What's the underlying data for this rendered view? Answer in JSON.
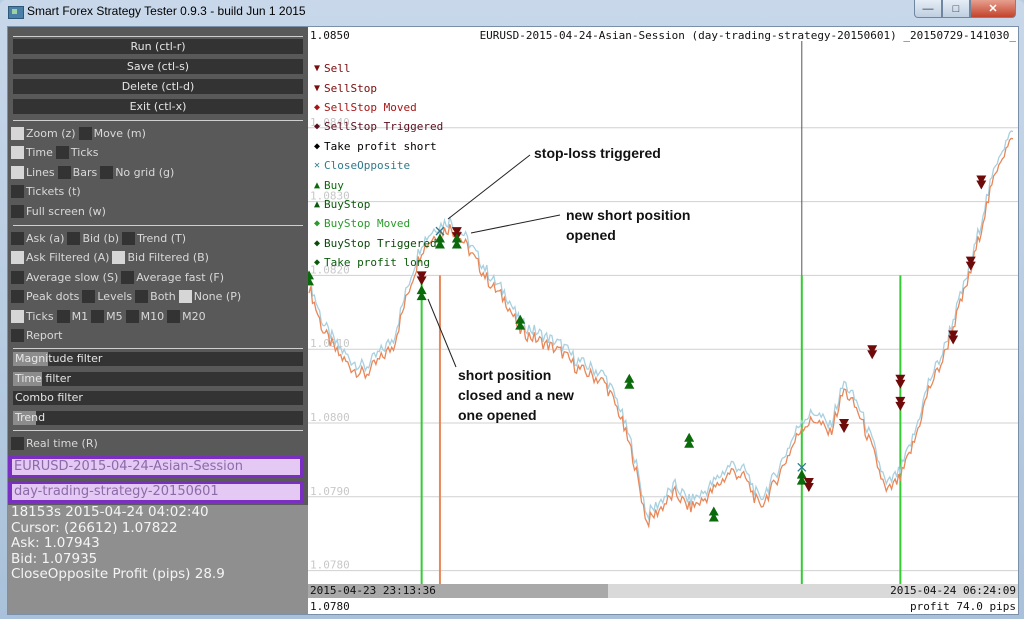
{
  "window": {
    "title": "Smart Forex Strategy Tester 0.9.3 - build Jun  1 2015",
    "controls": {
      "minimize": "—",
      "maximize": "□",
      "close": "✕"
    }
  },
  "panel": {
    "buttons": [
      {
        "label": "Run  (ctl-r)"
      },
      {
        "label": "Save  (ctl-s)"
      },
      {
        "label": "Delete  (ctl-d)"
      },
      {
        "label": "Exit  (ctl-x)"
      }
    ],
    "option_rows": [
      [
        {
          "label": "Zoom  (z)",
          "checked": true
        },
        {
          "label": "Move  (m)",
          "checked": false
        }
      ],
      [
        {
          "label": "Time",
          "checked": true
        },
        {
          "label": "Ticks",
          "checked": false
        }
      ],
      [
        {
          "label": "Lines",
          "checked": true
        },
        {
          "label": "Bars",
          "checked": false
        },
        {
          "label": "No  grid  (g)",
          "checked": false
        }
      ],
      [
        {
          "label": "Tickets  (t)",
          "checked": false
        }
      ],
      [
        {
          "label": "Full  screen  (w)",
          "checked": false
        }
      ]
    ],
    "indicator_rows": [
      [
        {
          "label": "Ask  (a)",
          "checked": false
        },
        {
          "label": "Bid  (b)",
          "checked": false
        },
        {
          "label": "Trend  (T)",
          "checked": false
        }
      ],
      [
        {
          "label": "Ask  Filtered  (A)",
          "checked": true
        },
        {
          "label": "Bid  Filtered  (B)",
          "checked": true
        }
      ],
      [
        {
          "label": "Average  slow  (S)",
          "checked": false
        },
        {
          "label": "Average  fast  (F)",
          "checked": false
        }
      ],
      [
        {
          "label": "Peak  dots",
          "checked": false
        },
        {
          "label": "Levels",
          "checked": false
        },
        {
          "label": "Both",
          "checked": false
        },
        {
          "label": "None  (P)",
          "checked": true
        }
      ],
      [
        {
          "label": "Ticks",
          "checked": true
        },
        {
          "label": "M1",
          "checked": false
        },
        {
          "label": "M5",
          "checked": false
        },
        {
          "label": "M10",
          "checked": false
        },
        {
          "label": "M20",
          "checked": false
        }
      ],
      [
        {
          "label": "Report",
          "checked": false
        }
      ]
    ],
    "sliders": [
      {
        "label": "Magnitude  filter",
        "value": 0.12
      },
      {
        "label": "Time  filter",
        "value": 0.1
      },
      {
        "label": "Combo  filter",
        "value": 0.0
      },
      {
        "label": "Trend",
        "value": 0.08
      }
    ],
    "realtime": {
      "label": "Real  time  (R)",
      "checked": false
    },
    "dataset_name": "EURUSD-2015-04-24-Asian-Session",
    "strategy_name": "day-trading-strategy-20150601",
    "info_lines": [
      "18153s  2015-04-24  04:02:40",
      "Cursor:  (26612)  1.07822",
      "Ask:  1.07943",
      "Bid:  1.07935",
      "CloseOpposite  Profit  (pips)  28.9"
    ]
  },
  "chart": {
    "top_price": "1.0850",
    "title": "EURUSD-2015-04-24-Asian-Session (day-trading-strategy-20150601) _20150729-141030_",
    "x_start": "2015-04-23 23:13:36",
    "x_end": "2015-04-24 06:24:09",
    "bottom_price": "1.0780",
    "profit": "profit 74.0 pips",
    "legend": [
      {
        "label": "Sell",
        "glyph": "▼",
        "color": "#7a0c0c",
        "icon": "sell-icon"
      },
      {
        "label": "SellStop",
        "glyph": "▼",
        "color": "#7a0c0c",
        "icon": "sellstop-icon"
      },
      {
        "label": "SellStop Moved",
        "glyph": "◆",
        "color": "#a81414",
        "icon": "sellstop-moved-icon"
      },
      {
        "label": "SellStop Triggered",
        "glyph": "◆",
        "color": "#5a0e1e",
        "icon": "sellstop-triggered-icon"
      },
      {
        "label": "Take profit short",
        "glyph": "◆",
        "color": "#000000",
        "icon": "take-profit-short-icon"
      },
      {
        "label": "CloseOpposite",
        "glyph": "✕",
        "color": "#2f7a8a",
        "icon": "close-opposite-icon"
      },
      {
        "label": "Buy",
        "glyph": "▲",
        "color": "#0b6a0b",
        "icon": "buy-icon"
      },
      {
        "label": "BuyStop",
        "glyph": "▲",
        "color": "#0b5a0b",
        "icon": "buystop-icon"
      },
      {
        "label": "BuyStop Moved",
        "glyph": "◆",
        "color": "#2a9a2a",
        "icon": "buystop-moved-icon"
      },
      {
        "label": "BuyStop Triggered",
        "glyph": "◆",
        "color": "#0b4a0b",
        "icon": "buystop-triggered-icon"
      },
      {
        "label": "Take profit long",
        "glyph": "◆",
        "color": "#0b5a0b",
        "icon": "take-profit-long-icon"
      }
    ],
    "annotations": {
      "stop_loss": "stop-loss triggered",
      "new_short": [
        "new short position",
        "opened"
      ],
      "short_closed": [
        "short position",
        "closed and a new",
        "one opened"
      ]
    },
    "colors": {
      "ask": "#a8d0e0",
      "bid": "#e8885a",
      "buy_line": "#33cc33",
      "sell_line": "#e8885a",
      "grid": "#d0d0d0"
    }
  },
  "chart_data": {
    "type": "line",
    "title": "EURUSD-2015-04-24-Asian-Session (day-trading-strategy-20150601) _20150729-141030_",
    "xlabel": "",
    "ylabel": "",
    "x_range": [
      "2015-04-23 23:13:36",
      "2015-04-24 06:24:09"
    ],
    "ylim": [
      1.0777,
      1.0852
    ],
    "y_ticks": [
      "1.0850",
      "1.0840",
      "1.0830",
      "1.0820",
      "1.0810",
      "1.0800",
      "1.0790",
      "1.0780"
    ],
    "grid": true,
    "legend_position": "top-left",
    "x_frac": [
      0.0,
      0.02,
      0.04,
      0.06,
      0.08,
      0.1,
      0.12,
      0.14,
      0.16,
      0.18,
      0.2,
      0.22,
      0.24,
      0.26,
      0.28,
      0.3,
      0.32,
      0.34,
      0.36,
      0.38,
      0.4,
      0.42,
      0.44,
      0.46,
      0.48,
      0.5,
      0.52,
      0.54,
      0.56,
      0.58,
      0.6,
      0.62,
      0.64,
      0.66,
      0.68,
      0.7,
      0.72,
      0.74,
      0.76,
      0.78,
      0.8,
      0.82,
      0.84,
      0.86,
      0.88,
      0.9,
      0.92,
      0.94,
      0.96,
      0.98,
      1.0
    ],
    "series": [
      {
        "name": "Ask Filtered",
        "values": [
          1.08195,
          1.08135,
          1.08105,
          1.08085,
          1.08075,
          1.08095,
          1.08115,
          1.08185,
          1.08245,
          1.08265,
          1.08275,
          1.08255,
          1.08225,
          1.08195,
          1.08175,
          1.08135,
          1.08125,
          1.08115,
          1.08105,
          1.08085,
          1.08075,
          1.08065,
          1.08025,
          1.07965,
          1.07875,
          1.07895,
          1.07915,
          1.07895,
          1.07905,
          1.07925,
          1.07945,
          1.07935,
          1.07895,
          1.07925,
          1.07965,
          1.08005,
          1.08015,
          1.07995,
          1.08055,
          1.08025,
          1.07975,
          1.07915,
          1.07935,
          1.07985,
          1.08055,
          1.08095,
          1.08155,
          1.08215,
          1.08295,
          1.08365,
          1.08395
        ]
      },
      {
        "name": "Bid Filtered",
        "values": [
          1.08185,
          1.08125,
          1.08095,
          1.08075,
          1.08065,
          1.08085,
          1.08105,
          1.08175,
          1.08235,
          1.08255,
          1.08265,
          1.08245,
          1.08215,
          1.08185,
          1.08165,
          1.08125,
          1.08115,
          1.08105,
          1.08095,
          1.08075,
          1.08065,
          1.08055,
          1.08015,
          1.07955,
          1.07865,
          1.07885,
          1.07905,
          1.07885,
          1.07895,
          1.07915,
          1.07935,
          1.07925,
          1.07885,
          1.07915,
          1.07955,
          1.07995,
          1.08005,
          1.07985,
          1.08045,
          1.08015,
          1.07965,
          1.07905,
          1.07925,
          1.07975,
          1.08045,
          1.08085,
          1.08145,
          1.08205,
          1.08285,
          1.08355,
          1.08385
        ]
      }
    ],
    "markers": [
      {
        "type": "buy",
        "x": 0.0,
        "y": 1.082
      },
      {
        "type": "buystop-triggered",
        "x": 0.16,
        "y": 1.0818
      },
      {
        "type": "sell",
        "x": 0.16,
        "y": 1.082
      },
      {
        "type": "close-opposite",
        "x": 0.186,
        "y": 1.0826
      },
      {
        "type": "buystop-triggered",
        "x": 0.186,
        "y": 1.0825
      },
      {
        "type": "sell",
        "x": 0.21,
        "y": 1.0826
      },
      {
        "type": "buy",
        "x": 0.21,
        "y": 1.0825
      },
      {
        "type": "buy",
        "x": 0.3,
        "y": 1.0814
      },
      {
        "type": "buy",
        "x": 0.455,
        "y": 1.0806
      },
      {
        "type": "buy",
        "x": 0.54,
        "y": 1.0798
      },
      {
        "type": "buy",
        "x": 0.575,
        "y": 1.0788
      },
      {
        "type": "close-opposite",
        "x": 0.7,
        "y": 1.0794
      },
      {
        "type": "buystop-triggered",
        "x": 0.7,
        "y": 1.0793
      },
      {
        "type": "sell",
        "x": 0.71,
        "y": 1.0792
      },
      {
        "type": "sell",
        "x": 0.76,
        "y": 1.08
      },
      {
        "type": "sell",
        "x": 0.8,
        "y": 1.081
      },
      {
        "type": "sell-triggered",
        "x": 0.84,
        "y": 1.0806
      },
      {
        "type": "sell",
        "x": 0.84,
        "y": 1.0803
      },
      {
        "type": "sell",
        "x": 0.915,
        "y": 1.0812
      },
      {
        "type": "sell",
        "x": 0.94,
        "y": 1.0822
      },
      {
        "type": "sell",
        "x": 0.955,
        "y": 1.0833
      }
    ],
    "vertical_lines": [
      {
        "kind": "buy",
        "x": 0.16
      },
      {
        "kind": "sell",
        "x": 0.186
      },
      {
        "kind": "cursor",
        "x": 0.7
      },
      {
        "kind": "buy",
        "x": 0.7
      },
      {
        "kind": "buy",
        "x": 0.84
      }
    ]
  }
}
